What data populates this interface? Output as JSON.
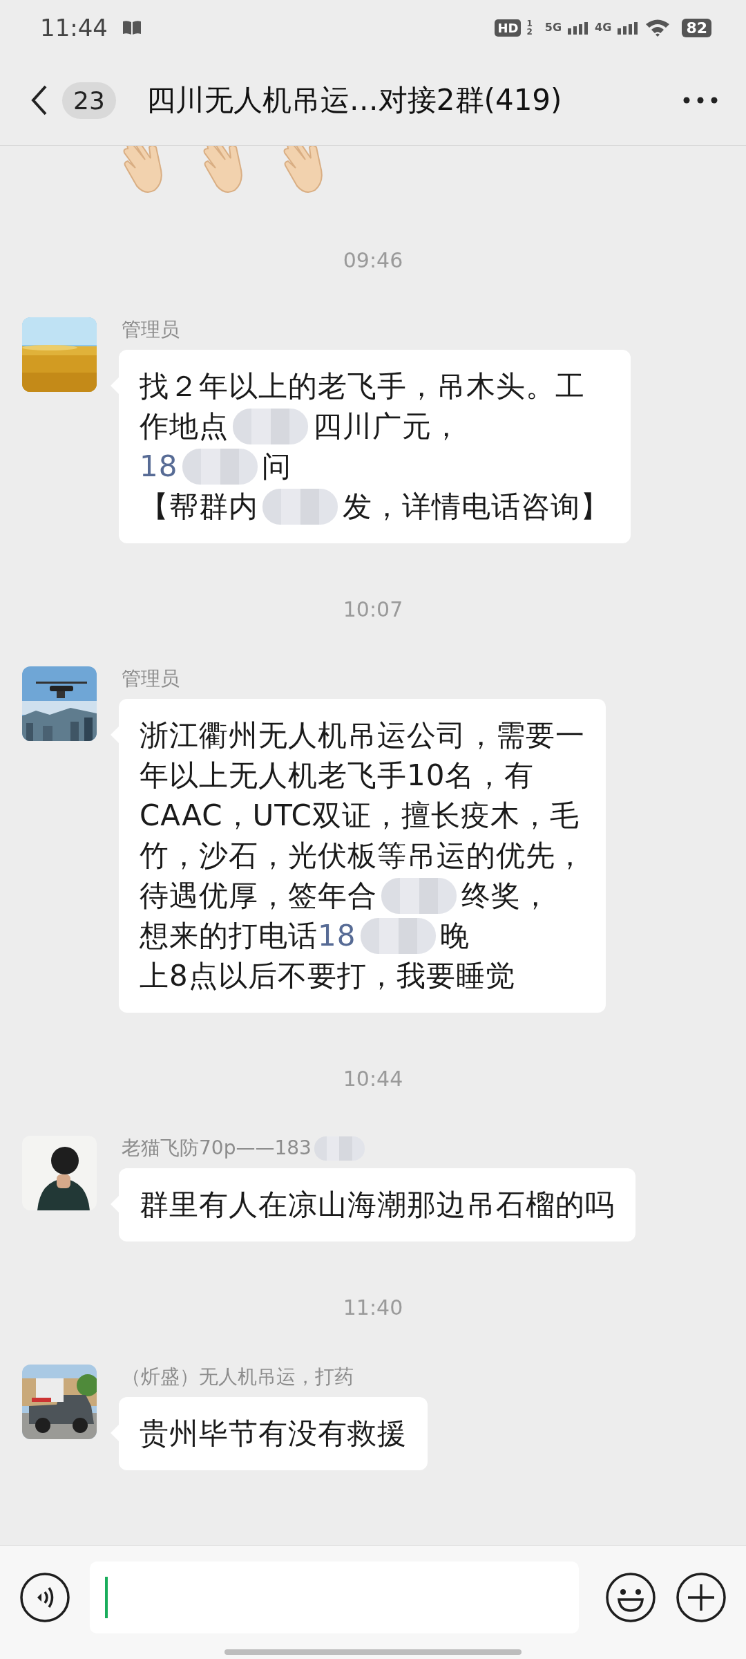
{
  "status_bar": {
    "time": "11:44",
    "hd": "HD",
    "hd_sub": [
      "1",
      "2"
    ],
    "net1": "5G",
    "net2": "4G",
    "battery": "82"
  },
  "header": {
    "unread": "23",
    "title": "四川无人机吊运…对接2群(419)"
  },
  "messages": [
    {
      "kind": "emoji_tail"
    },
    {
      "kind": "time",
      "text": "09:46"
    },
    {
      "kind": "message",
      "avatar": {
        "kind": "picture"
      },
      "sender": [
        {
          "kind": "text",
          "text": "管理员"
        }
      ],
      "lines": [
        [
          {
            "kind": "text",
            "text": "找２年以上的老飞手，吊木头。工"
          }
        ],
        [
          {
            "kind": "text",
            "text": "作地点"
          },
          {
            "kind": "redacted"
          },
          {
            "kind": "text",
            "text": "四川广元，"
          }
        ],
        [
          {
            "kind": "link",
            "text": "18"
          },
          {
            "kind": "redacted"
          },
          {
            "kind": "text",
            "text": "问"
          }
        ],
        [
          {
            "kind": "text",
            "text": "【帮群内"
          },
          {
            "kind": "redacted"
          },
          {
            "kind": "text",
            "text": "发，详情电话咨询】"
          }
        ]
      ]
    },
    {
      "kind": "time",
      "text": "10:07"
    },
    {
      "kind": "message",
      "avatar": {
        "kind": "picture"
      },
      "sender": [
        {
          "kind": "text",
          "text": "管理员"
        }
      ],
      "lines": [
        [
          {
            "kind": "text",
            "text": "浙江衢州无人机吊运公司，需要一"
          }
        ],
        [
          {
            "kind": "text",
            "text": "年以上无人机老飞手10名，有"
          }
        ],
        [
          {
            "kind": "text",
            "text": "CAAC，UTC双证，擅长疫木，毛"
          }
        ],
        [
          {
            "kind": "text",
            "text": "竹，沙石，光伏板等吊运的优先，"
          }
        ],
        [
          {
            "kind": "text",
            "text": "待遇优厚，签年合"
          },
          {
            "kind": "redacted"
          },
          {
            "kind": "text",
            "text": "终奖，"
          }
        ],
        [
          {
            "kind": "text",
            "text": "想来的打电话"
          },
          {
            "kind": "link",
            "text": "18"
          },
          {
            "kind": "redacted"
          },
          {
            "kind": "text",
            "text": "晚"
          }
        ],
        [
          {
            "kind": "text",
            "text": "上8点以后不要打，我要睡觉"
          }
        ]
      ]
    },
    {
      "kind": "time",
      "text": "10:44"
    },
    {
      "kind": "message",
      "avatar": {
        "kind": "silhouette"
      },
      "sender": [
        {
          "kind": "text",
          "text": "老猫飞防70p——183"
        },
        {
          "kind": "redacted"
        }
      ],
      "lines": [
        [
          {
            "kind": "text",
            "text": "群里有人在凉山海潮那边吊石榴的吗"
          }
        ]
      ]
    },
    {
      "kind": "time",
      "text": "11:40"
    },
    {
      "kind": "message",
      "avatar": {
        "kind": "picture"
      },
      "sender": [
        {
          "kind": "text",
          "text": "（炘盛）无人机吊运，打药"
        }
      ],
      "lines": [
        [
          {
            "kind": "text",
            "text": "贵州毕节有没有救援"
          }
        ]
      ]
    }
  ]
}
